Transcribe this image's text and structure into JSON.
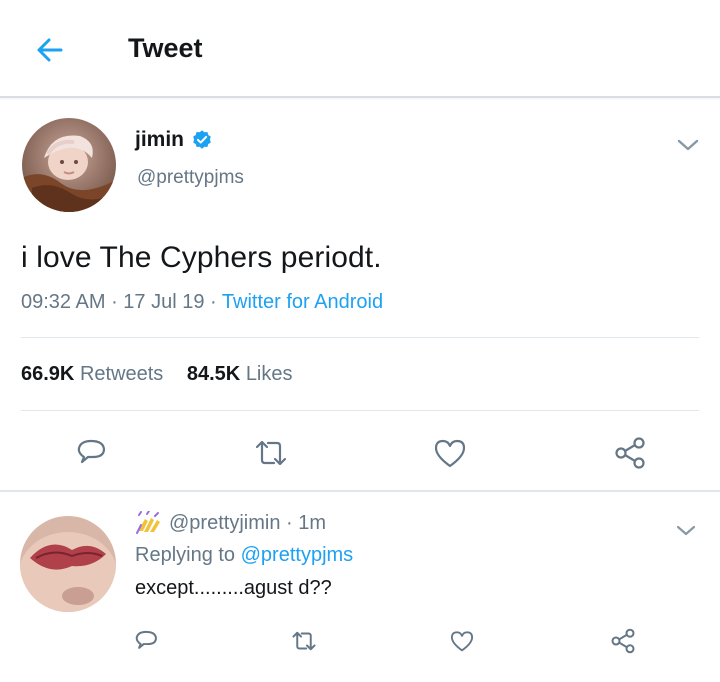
{
  "header": {
    "title": "Tweet"
  },
  "tweet": {
    "display_name": "jimin",
    "handle": "@prettypjms",
    "text": "i love The Cyphers periodt.",
    "time": "09:32 AM",
    "date": "17 Jul 19",
    "source": "Twitter for Android",
    "retweets_count": "66.9K",
    "retweets_label": "Retweets",
    "likes_count": "84.5K",
    "likes_label": "Likes"
  },
  "reply": {
    "handle": "@prettyjimin",
    "age": "1m",
    "replying_prefix": "Replying to",
    "replying_to": "@prettypjms",
    "text": "except.........agust d??"
  },
  "colors": {
    "accent": "#1da1f2",
    "secondary_text": "#657786",
    "primary_text": "#14171a",
    "verified": "#1da1f2"
  },
  "icons": [
    "back-arrow-icon",
    "verified-badge-icon",
    "chevron-down-icon",
    "reply-icon",
    "retweet-icon",
    "like-icon",
    "share-icon",
    "raising-hands-emoji-icon"
  ]
}
